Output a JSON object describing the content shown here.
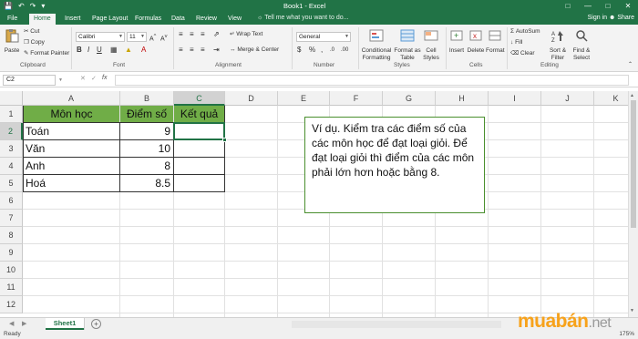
{
  "window": {
    "title": "Book1 - Excel",
    "signin": "Sign in",
    "share": "Share"
  },
  "tabs": [
    "File",
    "Home",
    "Insert",
    "Page Layout",
    "Formulas",
    "Data",
    "Review",
    "View"
  ],
  "tell_me": "Tell me what you want to do...",
  "ribbon": {
    "clipboard": {
      "paste": "Paste",
      "cut": "Cut",
      "copy": "Copy",
      "format_painter": "Format Painter",
      "label": "Clipboard"
    },
    "font": {
      "name": "Calibri",
      "size": "11",
      "label": "Font"
    },
    "alignment": {
      "wrap": "Wrap Text",
      "merge": "Merge & Center",
      "label": "Alignment"
    },
    "number": {
      "format": "General",
      "label": "Number"
    },
    "styles": {
      "conditional": "Conditional Formatting",
      "format_table": "Format as Table",
      "cell_styles": "Cell Styles",
      "label": "Styles"
    },
    "cells": {
      "insert": "Insert",
      "delete": "Delete",
      "format": "Format",
      "label": "Cells"
    },
    "editing": {
      "autosum": "AutoSum",
      "fill": "Fill",
      "clear": "Clear",
      "sort": "Sort & Filter",
      "find": "Find & Select",
      "label": "Editing"
    }
  },
  "formula_bar": {
    "name_box": "C2",
    "fx": "fx",
    "content": ""
  },
  "columns": [
    "A",
    "B",
    "C",
    "D",
    "E",
    "F",
    "G",
    "H",
    "I",
    "J",
    "K"
  ],
  "rows": [
    "1",
    "2",
    "3",
    "4",
    "5",
    "6",
    "7",
    "8",
    "9",
    "10",
    "11",
    "12"
  ],
  "table": {
    "headers": [
      "Môn học",
      "Điểm số",
      "Kết quả"
    ],
    "rows": [
      [
        "Toán",
        "9",
        ""
      ],
      [
        "Văn",
        "10",
        ""
      ],
      [
        "Anh",
        "8",
        ""
      ],
      [
        "Hoá",
        "8.5",
        ""
      ]
    ]
  },
  "textbox": "Ví dụ. Kiểm tra các điểm số của các môn học để đạt loại giỏi. Để đạt loại giỏi thì điểm của các môn phải lớn hơn hoặc bằng 8.",
  "sheet_tab": "Sheet1",
  "status": {
    "ready": "Ready",
    "zoom": "175%"
  },
  "watermark": {
    "brand": "muabán",
    "tld": ".net"
  },
  "colors": {
    "excel_green": "#217346",
    "header_fill": "#70ad47",
    "textbox_border": "#4a8f2e",
    "watermark": "#f7a21b"
  }
}
